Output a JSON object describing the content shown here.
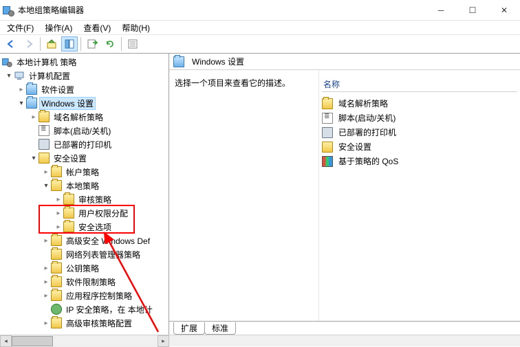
{
  "window": {
    "title": "本地组策略编辑器"
  },
  "menu": {
    "file": "文件(F)",
    "action": "操作(A)",
    "view": "查看(V)",
    "help": "帮助(H)"
  },
  "tree": {
    "root": "本地计算机 策略",
    "computer_config": "计算机配置",
    "software_settings": "软件设置",
    "windows_settings": "Windows 设置",
    "dns_policy": "域名解析策略",
    "scripts": "脚本(启动/关机)",
    "deployed_printers": "已部署的打印机",
    "security_settings": "安全设置",
    "account_policies": "帐户策略",
    "local_policies": "本地策略",
    "audit_policy": "审核策略",
    "user_rights": "用户权限分配",
    "security_options": "安全选项",
    "wfas": "高级安全 Windows Def",
    "nlm": "网络列表管理器策略",
    "public_key": "公钥策略",
    "srp": "软件限制策略",
    "app_control": "应用程序控制策略",
    "ipsec": "IP 安全策略，在 本地计",
    "adv_audit": "高级审核策略配置"
  },
  "detail": {
    "header": "Windows 设置",
    "prompt": "选择一个项目来查看它的描述。",
    "col_name": "名称",
    "items": {
      "dns": "域名解析策略",
      "scripts": "脚本(启动/关机)",
      "printers": "已部署的打印机",
      "security": "安全设置",
      "qos": "基于策略的 QoS"
    }
  },
  "tabs": {
    "extended": "扩展",
    "standard": "标准"
  }
}
